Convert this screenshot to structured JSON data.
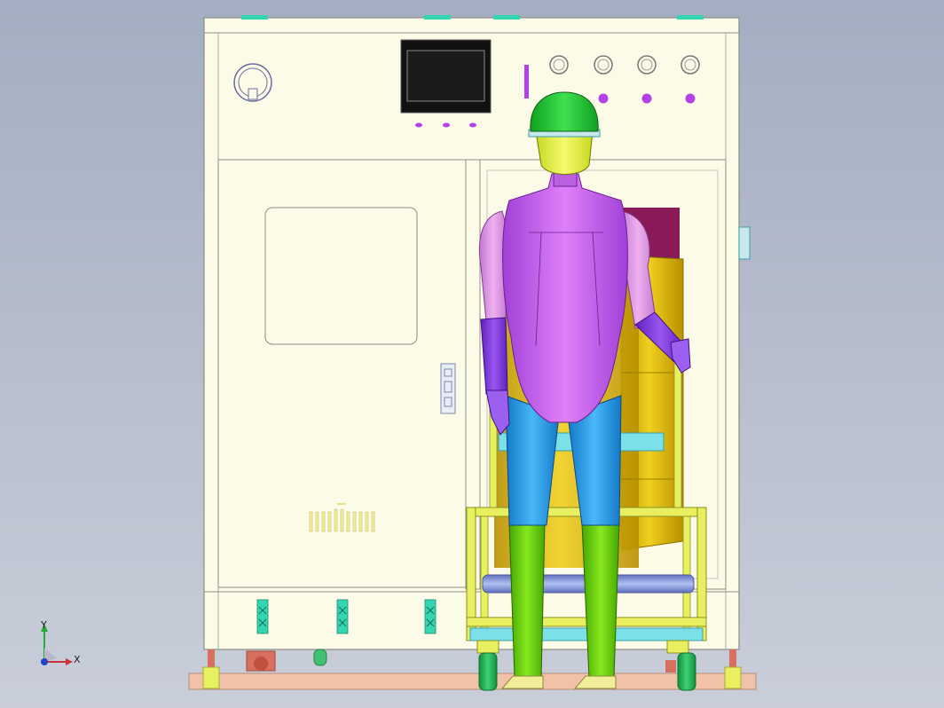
{
  "view": {
    "axes": {
      "x_label": "X",
      "y_label": "Y"
    }
  },
  "colors": {
    "cabinet": "#fcfbe8",
    "cabinet_edge": "#8d8d86",
    "base_plate": "#f2c2a8",
    "helmet": "#22cc33",
    "face": "#e6f24a",
    "torso": "#cc66ee",
    "upper_arm": "#e6a0ea",
    "forearm": "#8a44e0",
    "leg_upper": "#2aa0e8",
    "leg_lower": "#66d000",
    "drum": "#e3c20a",
    "cart_frame": "#e8f060",
    "roller": "#8aa0e0",
    "screen": "#111111",
    "indicator": "#b340e8",
    "vent": "#33d6b0"
  },
  "icons": {
    "emergency_stop": "knob-icon",
    "buttons": "round-button-icon",
    "vents": "vent-grille-icon"
  }
}
